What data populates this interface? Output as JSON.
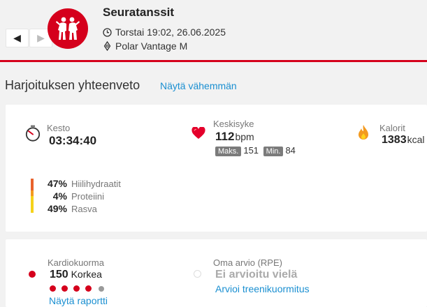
{
  "header": {
    "title": "Seuratanssit",
    "datetime": "Torstai 19:02, 26.06.2025",
    "device": "Polar Vantage M",
    "prev_glyph": "◀",
    "next_glyph": "▶"
  },
  "summary": {
    "section_title": "Harjoituksen yhteenveto",
    "toggle_link": "Näytä vähemmän",
    "duration": {
      "label": "Kesto",
      "value": "03:34:40"
    },
    "heart_rate": {
      "label": "Keskisyke",
      "value": "112",
      "unit": "bpm",
      "max_label": "Maks.",
      "max_value": "151",
      "min_label": "Min.",
      "min_value": "84"
    },
    "calories": {
      "label": "Kalorit",
      "value": "1383",
      "unit": "kcal"
    },
    "macros": [
      {
        "pct": "47%",
        "name": "Hiilihydraatit",
        "color": "#e8622c"
      },
      {
        "pct": "4%",
        "name": "Proteiini",
        "color": "#f39a1f"
      },
      {
        "pct": "49%",
        "name": "Rasva",
        "color": "#f5d21a"
      }
    ]
  },
  "load": {
    "cardio": {
      "label": "Kardiokuorma",
      "value": "150",
      "level": "Korkea",
      "scale_filled": 4,
      "scale_total": 5,
      "link": "Näytä raportti"
    },
    "rpe": {
      "label": "Oma arvio (RPE)",
      "value": "Ei arvioitu vielä",
      "link": "Arvioi treenikuormitus"
    }
  },
  "colors": {
    "accent": "#d5001c",
    "link": "#1a8fd1"
  }
}
